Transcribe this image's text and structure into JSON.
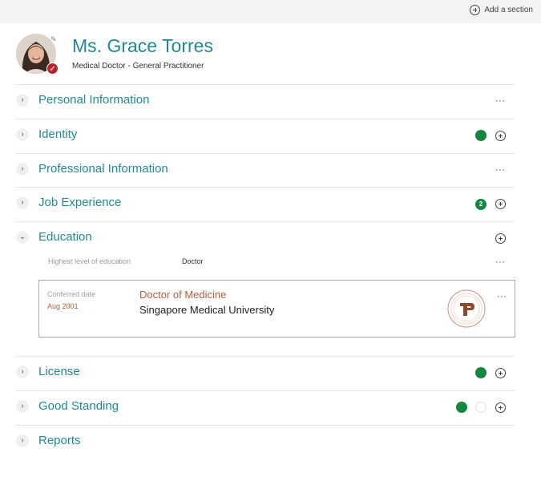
{
  "toolbar": {
    "add_section_label": "Add a section"
  },
  "profile": {
    "name": "Ms. Grace Torres",
    "subtitle": "Medical Doctor - General Practitioner",
    "verified_icon": "check-icon",
    "edit_icon": "pencil-icon"
  },
  "sections": [
    {
      "title": "Personal Information",
      "expanded": false,
      "actions": [
        "more"
      ]
    },
    {
      "title": "Identity",
      "expanded": false,
      "status_dots": [
        "green"
      ],
      "actions": [
        "add"
      ]
    },
    {
      "title": "Professional Information",
      "expanded": false,
      "actions": [
        "more"
      ]
    },
    {
      "title": "Job Experience",
      "expanded": false,
      "count_badge": "2",
      "actions": [
        "add"
      ]
    },
    {
      "title": "Education",
      "expanded": true,
      "actions": [
        "add"
      ]
    },
    {
      "title": "License",
      "expanded": false,
      "status_dots": [
        "green"
      ],
      "actions": [
        "add"
      ]
    },
    {
      "title": "Good Standing",
      "expanded": false,
      "status_dots": [
        "green",
        "empty"
      ],
      "actions": [
        "add"
      ]
    },
    {
      "title": "Reports",
      "expanded": false,
      "actions": []
    }
  ],
  "education": {
    "field_label": "Highest level of education",
    "field_value": "Doctor",
    "record": {
      "conferred_label": "Conferred date",
      "conferred_date": "Aug 2001",
      "degree": "Doctor of Medicine",
      "institution": "Singapore Medical University",
      "seal_letter": "P"
    }
  },
  "colors": {
    "accent": "#1f8a94",
    "status_green": "#12883f",
    "degree_brown": "#b05e3b",
    "verified_red": "#b1272f"
  }
}
